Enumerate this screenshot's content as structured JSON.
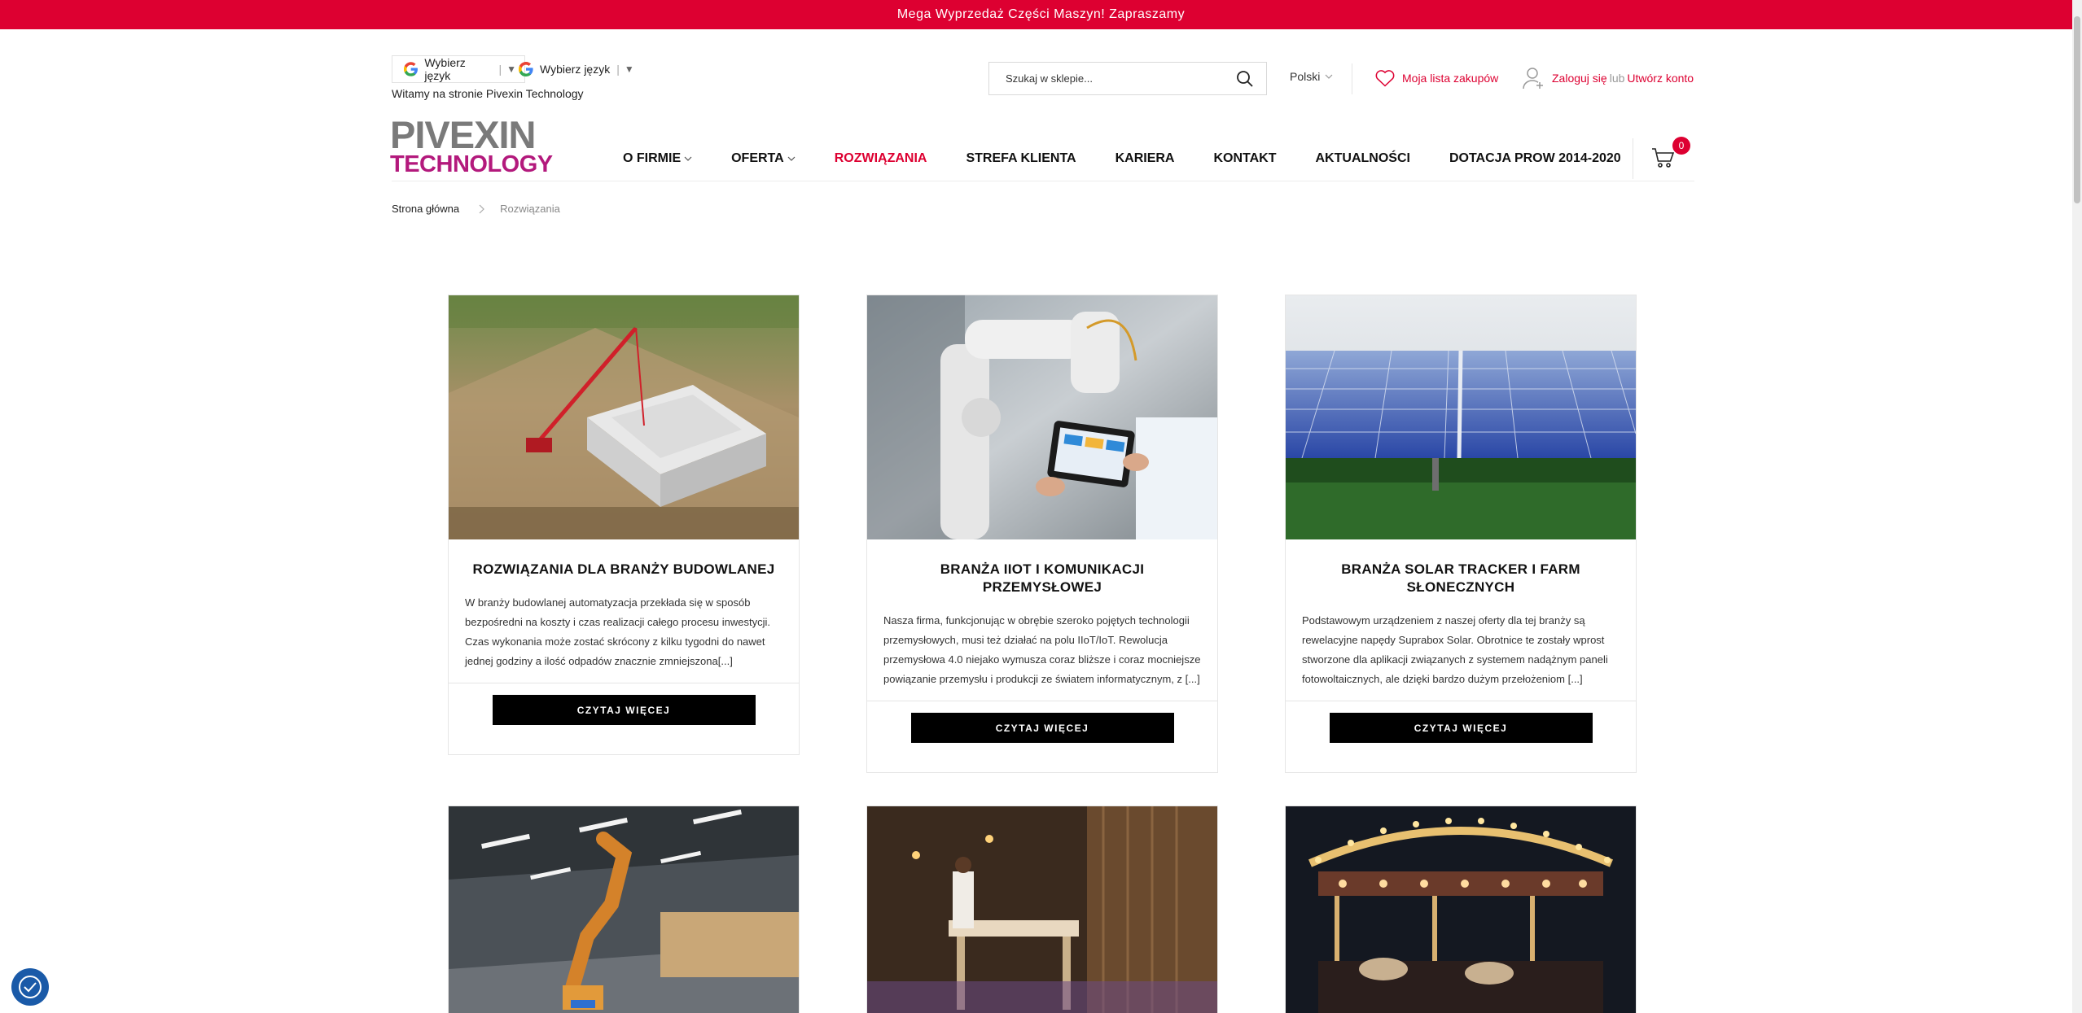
{
  "promo_bar": {
    "text": "Mega Wyprzedaż Części Maszyn! Zapraszamy"
  },
  "header": {
    "translate_widgets": [
      {
        "label": "Wybierz język",
        "arrow": "▼"
      },
      {
        "label": "Wybierz język",
        "arrow": "▼"
      }
    ],
    "welcome": "Witamy na stronie Pivexin Technology",
    "search": {
      "placeholder": "Szukaj w sklepie..."
    },
    "language": "Polski",
    "wishlist": "Moja lista zakupów",
    "account": {
      "login": "Zaloguj się",
      "or": "lub",
      "register": "Utwórz konto"
    },
    "logo": {
      "line1": "PIVEXIN",
      "line2": "TECHNOLOGY"
    },
    "cart_count": "0"
  },
  "nav": {
    "items": [
      {
        "label": "O FIRMIE",
        "dropdown": true
      },
      {
        "label": "OFERTA",
        "dropdown": true
      },
      {
        "label": "ROZWIĄZANIA",
        "active": true
      },
      {
        "label": "STREFA KLIENTA"
      },
      {
        "label": "KARIERA"
      },
      {
        "label": "KONTAKT"
      },
      {
        "label": "AKTUALNOŚCI"
      },
      {
        "label": "DOTACJA PROW 2014-2020"
      }
    ]
  },
  "breadcrumb": {
    "home": "Strona główna",
    "current": "Rozwiązania"
  },
  "cards": [
    {
      "title": "ROZWIĄZANIA DLA BRANŻY BUDOWLANEJ",
      "text": "W branży budowlanej automatyzacja przekłada się w sposób bezpośredni na koszty i czas realizacji całego procesu inwestycji. Czas wykonania może zostać skrócony z kilku tygodni do nawet jednej godziny a ilość odpadów znacznie zmniejszona[...]",
      "button": "CZYTAJ WIĘCEJ"
    },
    {
      "title": "BRANŻA IIOT I KOMUNIKACJI PRZEMYSŁOWEJ",
      "text": "Nasza firma, funkcjonując w obrębie szeroko pojętych technologii przemysłowych, musi też działać na polu IIoT/IoT. Rewolucja przemysłowa 4.0 niejako wymusza coraz bliższe i coraz mocniejsze powiązanie przemysłu i produkcji ze światem informatycznym, z [...]",
      "button": "CZYTAJ WIĘCEJ"
    },
    {
      "title": "BRANŻA SOLAR TRACKER I FARM SŁONECZNYCH",
      "text": "Podstawowym urządzeniem z naszej oferty dla tej branży są rewelacyjne napędy Suprabox Solar. Obrotnice te zostały wprost stworzone dla aplikacji związanych z systemem nadążnym paneli fotowoltaicznych, ale dzięki bardzo dużym przełożeniom [...]",
      "button": "CZYTAJ WIĘCEJ"
    }
  ],
  "colors": {
    "brand_red": "#dd0031",
    "logo_grey": "#7a7a7a",
    "logo_magenta": "#b3197c"
  }
}
